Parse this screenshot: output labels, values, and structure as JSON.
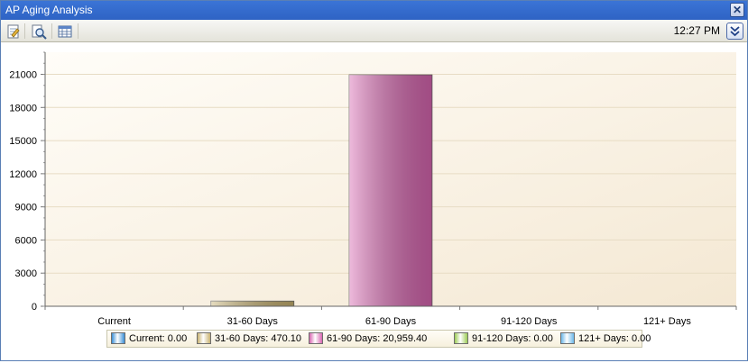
{
  "window": {
    "title": "AP Aging Analysis",
    "close_icon": "close-icon"
  },
  "toolbar": {
    "buttons": [
      {
        "name": "refresh-button",
        "icon": "edit-document-icon"
      },
      {
        "name": "print-preview-button",
        "icon": "magnifier-document-icon"
      },
      {
        "name": "data-table-button",
        "icon": "table-grid-icon"
      }
    ],
    "time": "12:27 PM",
    "expand_icon": "double-chevron-down-icon"
  },
  "chart_data": {
    "type": "bar",
    "title": "",
    "xlabel": "",
    "ylabel": "",
    "categories": [
      "Current",
      "31-60 Days",
      "61-90 Days",
      "91-120 Days",
      "121+ Days"
    ],
    "values": [
      0.0,
      470.1,
      20959.4,
      0.0,
      0.0
    ],
    "ylim": [
      0,
      23000
    ],
    "yticks": [
      "0",
      "3000",
      "6000",
      "9000",
      "12000",
      "15000",
      "18000",
      "21000"
    ],
    "grid": true,
    "legend_position": "bottom",
    "colors": [
      "#3a8fd6",
      "#c8b270",
      "#d865b0",
      "#9ccc55",
      "#6cb8ea"
    ],
    "legend": [
      "Current: 0.00",
      "31-60 Days: 470.10",
      "61-90 Days: 20,959.40",
      "91-120 Days: 0.00",
      "121+ Days: 0.00"
    ]
  }
}
